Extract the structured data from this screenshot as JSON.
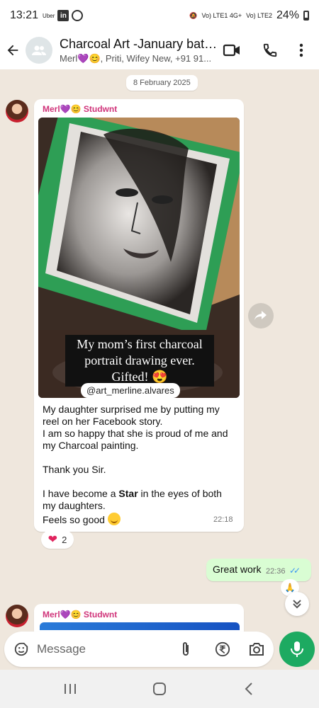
{
  "status_bar": {
    "time": "13:21",
    "uber_label": "Uber",
    "network_1": "Vo) LTE1 4G+",
    "network_2": "Vo) LTE2",
    "battery": "24%"
  },
  "header": {
    "title": "Charcoal Art -January batch...",
    "subtitle": "Merl💜😊, Priti, Wifey New, +91 91..."
  },
  "chat": {
    "date_chip": "8 February 2025",
    "message_1": {
      "sender": "Merl💜😊 Studwnt",
      "media_caption": "My mom’s first charcoal portrait drawing ever. Gifted! 😍",
      "media_handle": "@art_merline.alvares",
      "lines": {
        "p1": "My daughter surprised me by putting my reel on her Facebook story.",
        "p2": "I am so happy that she is proud of me and my Charcoal painting.",
        "p3": "Thank you Sir.",
        "p4_before": "I have become a ",
        "p4_bold": "Star",
        "p4_after": " in the eyes of both my daughters.",
        "p5": "Feels so good"
      },
      "time": "22:18",
      "reaction": {
        "emoji": "❤",
        "count": "2"
      }
    },
    "message_2": {
      "text": "Great work",
      "time": "22:36",
      "reaction_emoji": "🙏"
    },
    "message_3": {
      "sender": "Merl💜😊 Studwnt"
    }
  },
  "input": {
    "placeholder": "Message"
  },
  "colors": {
    "accent_green": "#1daa61",
    "outgoing_bubble": "#d9fdd3",
    "sender_name": "#d0347a",
    "read_ticks": "#3b96f3"
  },
  "icons": [
    "back-arrow-icon",
    "group-icon",
    "video-call-icon",
    "phone-icon",
    "more-vert-icon",
    "forward-icon",
    "sticker-icon",
    "attach-icon",
    "rupee-icon",
    "camera-icon",
    "mic-icon",
    "recents-icon",
    "home-icon",
    "back-nav-icon",
    "chevron-double-down-icon"
  ]
}
